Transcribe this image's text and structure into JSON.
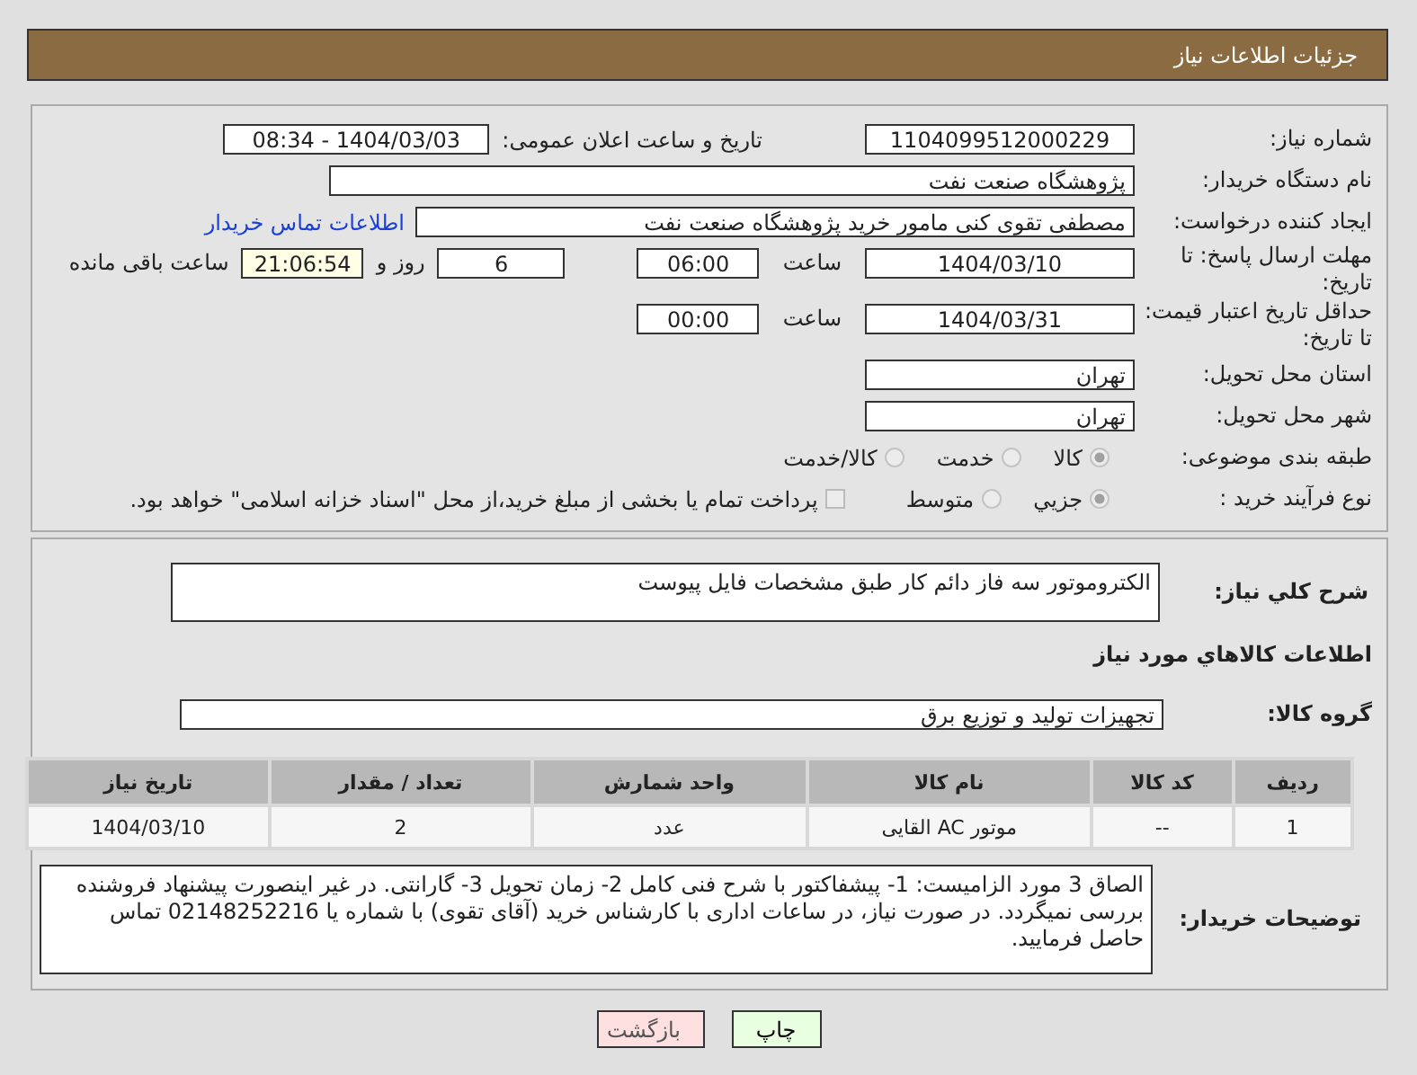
{
  "header": {
    "title": "جزئیات اطلاعات نیاز"
  },
  "need_number": {
    "label": "شماره نیاز:",
    "value": "1104099512000229"
  },
  "announce": {
    "label": "تاریخ و ساعت اعلان عمومی:",
    "value": "1404/03/03 - 08:34"
  },
  "buyer_org": {
    "label": "نام دستگاه خریدار:",
    "value": "پژوهشگاه صنعت نفت"
  },
  "requester": {
    "label": "ایجاد کننده درخواست:",
    "value": "مصطفی تقوی کنی مامور خرید پژوهشگاه صنعت نفت",
    "link": "اطلاعات تماس خریدار"
  },
  "deadline": {
    "label": "مهلت ارسال پاسخ: تا تاریخ:",
    "date": "1404/03/10",
    "time_label": "ساعت",
    "time": "06:00",
    "days": "6",
    "days_label": "روز و",
    "remaining": "21:06:54",
    "remaining_label": "ساعت باقی مانده"
  },
  "validity": {
    "label": "حداقل تاریخ اعتبار قیمت: تا تاریخ:",
    "date": "1404/03/31",
    "time_label": "ساعت",
    "time": "00:00"
  },
  "province": {
    "label": "استان محل تحویل:",
    "value": "تهران"
  },
  "city": {
    "label": "شهر محل تحویل:",
    "value": "تهران"
  },
  "category": {
    "label": "طبقه بندی موضوعی:",
    "options": [
      {
        "label": "کالا",
        "selected": true
      },
      {
        "label": "خدمت",
        "selected": false
      },
      {
        "label": "کالا/خدمت",
        "selected": false
      }
    ]
  },
  "purchase_type": {
    "label": "نوع فرآیند خرید :",
    "options": [
      {
        "label": "جزیي",
        "selected": true
      },
      {
        "label": "متوسط",
        "selected": false
      }
    ],
    "checkbox": {
      "label": "پرداخت تمام یا بخشی از مبلغ خرید،از محل \"اسناد خزانه اسلامی\" خواهد بود.",
      "checked": false
    }
  },
  "description": {
    "label": "شرح كلي نياز:",
    "value": "الکتروموتور سه فاز دائم کار طبق مشخصات فایل پیوست"
  },
  "goods_heading": "اطلاعات كالاهاي مورد نياز",
  "group": {
    "label": "گروه کالا:",
    "value": "تجهیزات تولید و توزیع برق"
  },
  "table": {
    "columns": [
      "ردیف",
      "کد کالا",
      "نام کالا",
      "واحد شمارش",
      "تعداد / مقدار",
      "تاریخ نیاز"
    ],
    "rows": [
      [
        "1",
        "--",
        "موتور AC القایی",
        "عدد",
        "2",
        "1404/03/10"
      ]
    ]
  },
  "buyer_notes": {
    "label": "توضیحات خریدار:",
    "value": "الصاق 3 مورد الزامیست: 1- پیشفاکتور با شرح فنی کامل 2- زمان تحویل 3- گارانتی. در غیر اینصورت پیشنهاد فروشنده بررسی نمیگردد. در صورت نیاز، در ساعات اداری با کارشناس خرید (آقای تقوی) با شماره یا 02148252216 تماس حاصل فرمایید."
  },
  "buttons": [
    {
      "label": "چاپ",
      "kind": "print"
    },
    {
      "label": "بازگشت",
      "kind": "back"
    }
  ]
}
